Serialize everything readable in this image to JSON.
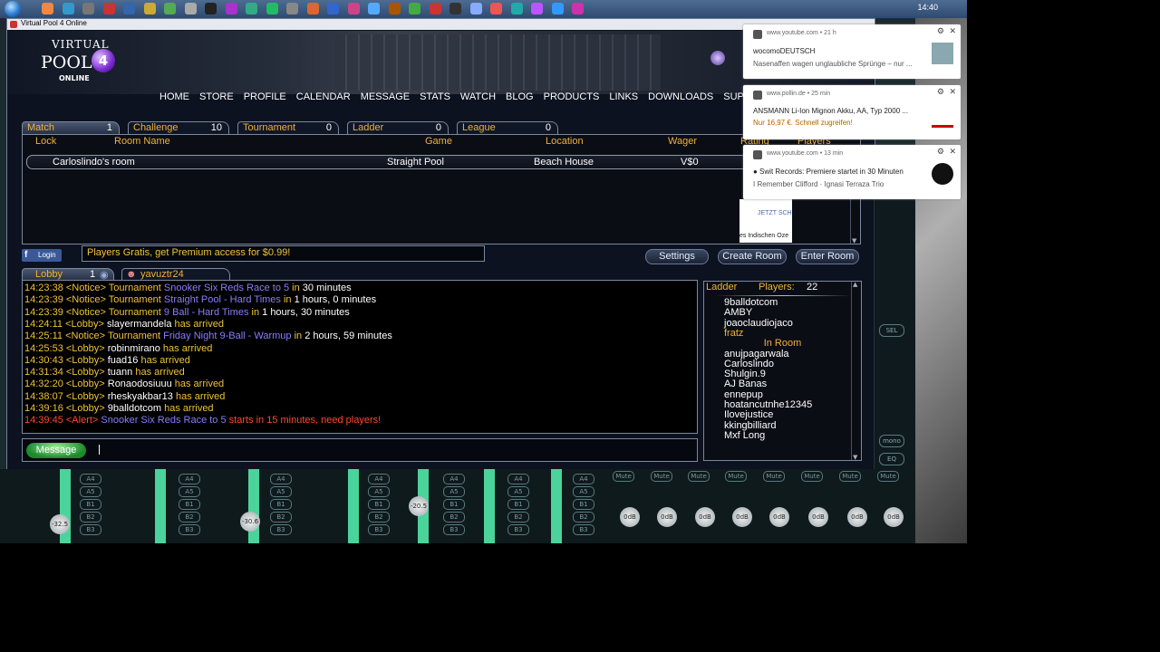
{
  "taskbar": {
    "clock": "14:40"
  },
  "window": {
    "title": "Virtual Pool 4 Online"
  },
  "logo": {
    "line1": "VIRTUAL",
    "line2": "POOL",
    "ball": "4",
    "line3": "ONLINE"
  },
  "nav": [
    "HOME",
    "STORE",
    "PROFILE",
    "CALENDAR",
    "MESSAGE",
    "STATS",
    "WATCH",
    "BLOG",
    "PRODUCTS",
    "LINKS",
    "DOWNLOADS",
    "SUPPORT"
  ],
  "room_tabs": [
    {
      "label": "Match",
      "count": "1"
    },
    {
      "label": "Challenge",
      "count": "10"
    },
    {
      "label": "Tournament",
      "count": "0"
    },
    {
      "label": "Ladder",
      "count": "0"
    },
    {
      "label": "League",
      "count": "0"
    }
  ],
  "room_columns": [
    "Lock",
    "Room Name",
    "Game",
    "Location",
    "Wager",
    "Rating",
    "Players"
  ],
  "rooms": [
    {
      "name": "Carloslindo's room",
      "game": "Straight Pool",
      "location": "Beach House",
      "wager": "V$0"
    }
  ],
  "facebook": {
    "f": "f",
    "label": "Login"
  },
  "promo": "Players Gratis, get Premium access for $0.99!",
  "buttons": {
    "settings": "Settings",
    "create": "Create Room",
    "enter": "Enter Room",
    "message": "Message"
  },
  "chat_tabs": [
    {
      "label": "Lobby",
      "count": "1"
    },
    {
      "label": "yavuztr24"
    }
  ],
  "chat": [
    {
      "ts": "14:23:38",
      "who": "<Notice>",
      "parts": [
        [
          "w",
          "Tournament "
        ],
        [
          "p",
          "Snooker Six Reds Race to 5"
        ],
        [
          "w",
          " in "
        ],
        [
          "nm",
          "30 minutes"
        ]
      ]
    },
    {
      "ts": "14:23:39",
      "who": "<Notice>",
      "parts": [
        [
          "w",
          "Tournament "
        ],
        [
          "p",
          "Straight Pool - Hard Times"
        ],
        [
          "w",
          " in "
        ],
        [
          "nm",
          "1 hours, 0 minutes"
        ]
      ]
    },
    {
      "ts": "14:23:39",
      "who": "<Notice>",
      "parts": [
        [
          "w",
          "Tournament "
        ],
        [
          "p",
          "9 Ball - Hard Times"
        ],
        [
          "w",
          " in "
        ],
        [
          "nm",
          "1 hours, 30 minutes"
        ]
      ]
    },
    {
      "ts": "14:24:11",
      "who": "<Lobby>",
      "parts": [
        [
          "nm",
          "slayermandela"
        ],
        [
          "w",
          " has arrived"
        ]
      ]
    },
    {
      "ts": "14:25:11",
      "who": "<Notice>",
      "parts": [
        [
          "w",
          "Tournament "
        ],
        [
          "p",
          "Friday Night 9-Ball - Warmup"
        ],
        [
          "w",
          " in "
        ],
        [
          "nm",
          "2 hours, 59 minutes"
        ]
      ]
    },
    {
      "ts": "14:25:53",
      "who": "<Lobby>",
      "parts": [
        [
          "nm",
          "robinmirano"
        ],
        [
          "w",
          " has arrived"
        ]
      ]
    },
    {
      "ts": "14:30:43",
      "who": "<Lobby>",
      "parts": [
        [
          "nm",
          "fuad16"
        ],
        [
          "w",
          " has arrived"
        ]
      ]
    },
    {
      "ts": "14:31:34",
      "who": "<Lobby>",
      "parts": [
        [
          "nm",
          "tuann"
        ],
        [
          "w",
          " has arrived"
        ]
      ]
    },
    {
      "ts": "14:32:20",
      "who": "<Lobby>",
      "parts": [
        [
          "nm",
          "Ronaodosiuuu"
        ],
        [
          "w",
          " has arrived"
        ]
      ]
    },
    {
      "ts": "14:38:07",
      "who": "<Lobby>",
      "parts": [
        [
          "nm",
          "rheskyakbar13"
        ],
        [
          "w",
          " has arrived"
        ]
      ]
    },
    {
      "ts": "14:39:16",
      "who": "<Lobby>",
      "parts": [
        [
          "nm",
          "9balldotcom"
        ],
        [
          "w",
          " has arrived"
        ]
      ]
    },
    {
      "ts": "14:39:45",
      "who": "<Alert>",
      "alert": true,
      "parts": [
        [
          "p",
          "Snooker Six Reds Race to 5"
        ],
        [
          "r",
          " starts in 15 minutes, need players!"
        ]
      ]
    }
  ],
  "ladder": {
    "title": "Ladder",
    "players_label": "Players:",
    "count": "22",
    "top": [
      {
        "n": "9balldotcom"
      },
      {
        "n": "AMBY"
      },
      {
        "n": "joaoclaudiojaco"
      },
      {
        "n": "fratz",
        "gold": true
      }
    ],
    "in_room_label": "In Room",
    "room": [
      "anujpagarwala",
      "Carloslindo",
      "Shulgin.9",
      "AJ Banas",
      "ennepup",
      "hoatancutnhe12345",
      "Ilovejustice",
      "kkingbilliard",
      "Mxf Long"
    ]
  },
  "notifications": [
    {
      "src": "www.youtube.com • 21 h",
      "title": "wocomoDEUTSCH",
      "body": "Nasenaffen wagen unglaubliche Sprünge – nur ..."
    },
    {
      "src": "www.pollin.de • 25 min",
      "title": "ANSMANN Li-Ion Mignon Akku, AA, Typ 2000 ...",
      "body": "Nur 16,97 €. Schnell zugreifen!"
    },
    {
      "src": "www.youtube.com • 13 min",
      "title": "● Swit Records: Premiere startet in 30 Minuten",
      "body": "I Remember Clifford · Ignasi Terraza Trio"
    }
  ],
  "side_fragments": {
    "btn": "JETZT SCH",
    "text": "es Indischen Oze"
  },
  "mixer": {
    "knobs": [
      "-32.5",
      "-30.6",
      "-20.5",
      "0dB",
      "0dB",
      "0dB",
      "0dB",
      "0dB",
      "0dB",
      "0dB",
      "0dB"
    ]
  }
}
